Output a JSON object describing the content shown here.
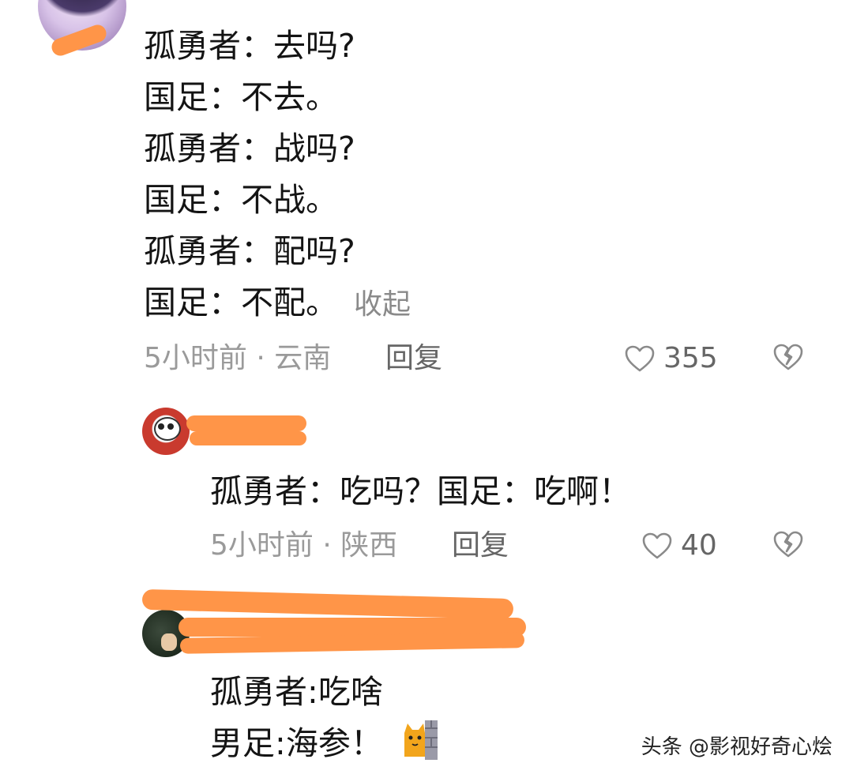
{
  "comment_main": {
    "lines": [
      {
        "speaker": "孤勇者：",
        "text": "去吗?"
      },
      {
        "speaker": "国足：",
        "text": "不去。"
      },
      {
        "speaker": "孤勇者：",
        "text": "战吗?"
      },
      {
        "speaker": "国足：",
        "text": "不战。"
      },
      {
        "speaker": "孤勇者：",
        "text": "配吗?"
      },
      {
        "speaker": "国足：",
        "text": "不配。"
      }
    ],
    "collapse_label": "收起",
    "meta": "5小时前 · 云南",
    "reply_label": "回复",
    "like_count": "355"
  },
  "reply_1": {
    "text": "孤勇者：吃吗？国足：吃啊！",
    "meta": "5小时前 · 陕西",
    "reply_label": "回复",
    "like_count": "40"
  },
  "reply_2": {
    "lines": [
      "孤勇者:吃啥",
      "男足:海参！"
    ]
  },
  "watermark": "头条 @影视好奇心烩",
  "icons": {
    "like": "heart-outline-icon",
    "dislike": "broken-heart-icon",
    "emoji": "cat-peek-emoji"
  },
  "colors": {
    "redaction": "#ff9548",
    "meta_text": "#9a9a9a",
    "body_text": "#141414"
  }
}
